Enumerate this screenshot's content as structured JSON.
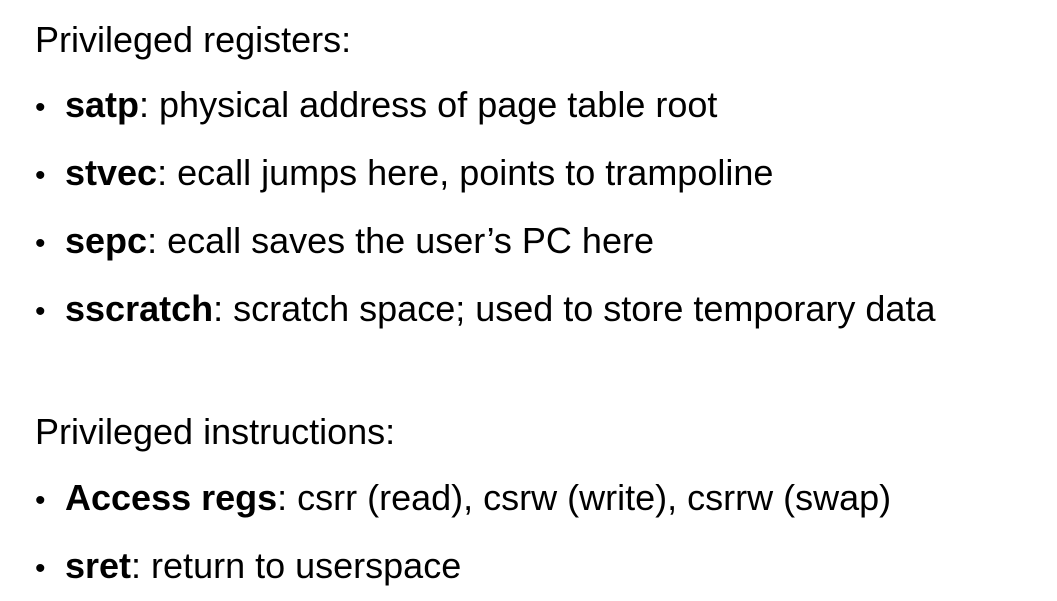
{
  "sections": [
    {
      "heading": "Privileged registers:",
      "items": [
        {
          "term": "satp",
          "description": ": physical address of page table root"
        },
        {
          "term": "stvec",
          "description": ": ecall jumps here, points to trampoline"
        },
        {
          "term": "sepc",
          "description": ": ecall saves the user’s PC here"
        },
        {
          "term": "sscratch",
          "description": ": scratch space; used to store temporary data"
        }
      ]
    },
    {
      "heading": "Privileged instructions:",
      "items": [
        {
          "term": "Access regs",
          "description": ": csrr (read), csrw (write), csrrw (swap)"
        },
        {
          "term": "sret",
          "description": ": return to userspace"
        }
      ]
    }
  ],
  "bullet_glyph": "•"
}
